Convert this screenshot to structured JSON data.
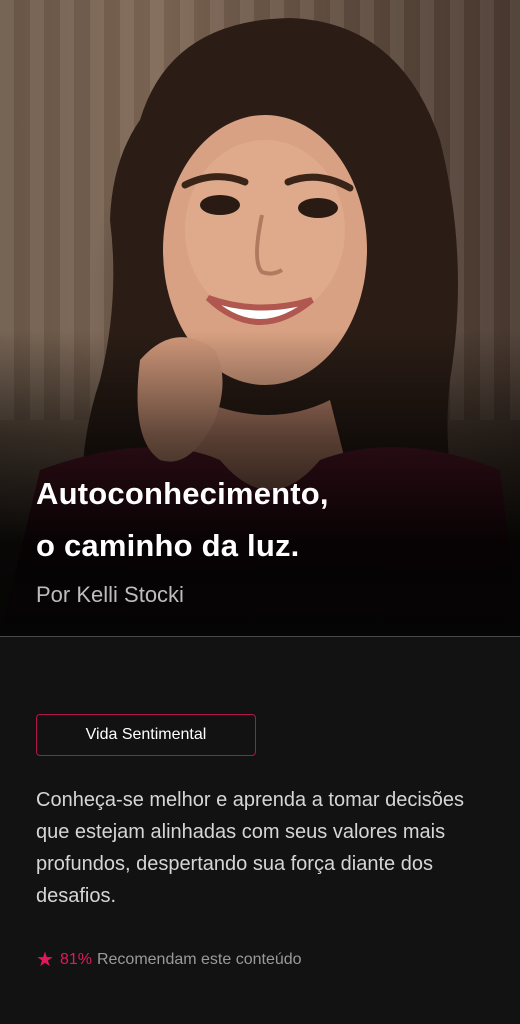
{
  "hero": {
    "title_line1": "Autoconhecimento,",
    "title_line2": "o caminho da luz.",
    "author": "Por Kelli Stocki"
  },
  "content": {
    "category": "Vida Sentimental",
    "description": "Conheça-se melhor e aprenda a tomar decisões que estejam alinhadas com seus valores mais profundos, despertando sua força diante dos desafios.",
    "rating": {
      "icon": "star-icon",
      "percent": "81%",
      "label": "Recomendam este conteúdo"
    }
  },
  "colors": {
    "accent": "#e01a5a",
    "border_accent": "#b3144a",
    "background": "#121212"
  }
}
